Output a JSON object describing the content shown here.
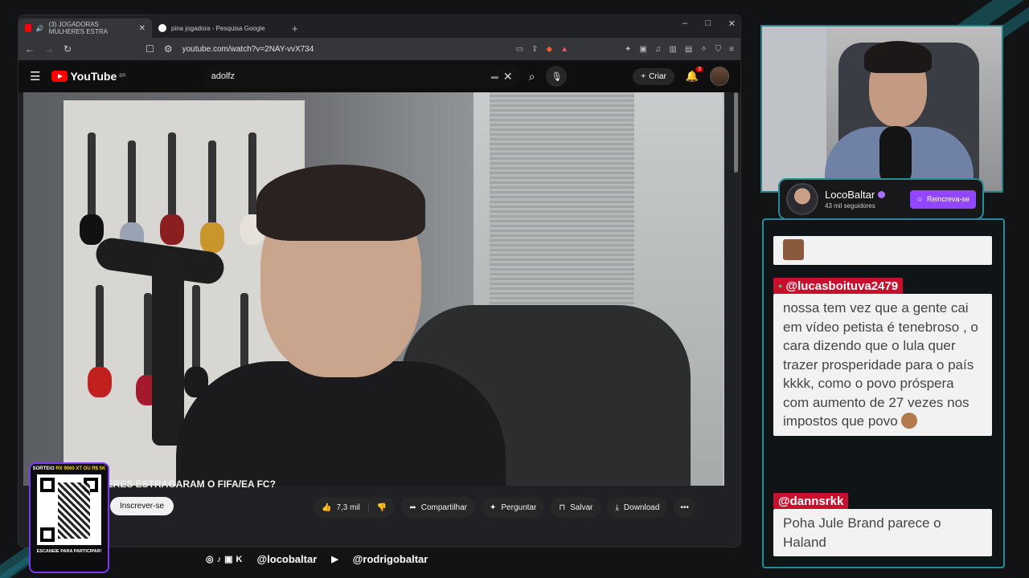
{
  "browser": {
    "tabs": [
      {
        "label": "(3) JOGADORAS MULHERES ESTRA",
        "active": true
      },
      {
        "label": "pina jogadora - Pesquisa Google",
        "active": false
      }
    ],
    "new_tab": "+",
    "url": "youtube.com/watch?v=2NAY-vvX734",
    "window_controls": {
      "minimize": "–",
      "maximize": "□",
      "close": "✕"
    }
  },
  "youtube": {
    "logo_text": "YouTube",
    "logo_region": "BR",
    "search_value": "adolfz",
    "create_label": "Criar",
    "notification_count": "3",
    "video_title": "HERES ESTRAGARAM O FIFA/EA FC?",
    "subscribe_label": "Inscrever-se",
    "likes": "7,3 mil",
    "share_label": "Compartilhar",
    "ask_label": "Perguntar",
    "save_label": "Salvar",
    "download_label": "Download",
    "more_label": "•••"
  },
  "stream": {
    "channel_name": "LocoBaltar",
    "followers": "43 mil seguidores",
    "resub_label": "Reincreva-se",
    "chat": [
      {
        "author": "",
        "text": ""
      },
      {
        "author": "@lucasboituva2479",
        "text": "nossa tem vez que a gente cai em vídeo petista é tenebroso , o cara dizendo que o lula quer trazer prosperidade para o país kkkk, como o povo próspera com aumento de 27 vezes nos impostos que povo"
      },
      {
        "author": "@dannsrkk",
        "text": "Poha Jule Brand parece o Haland"
      }
    ],
    "qr_top_prefix": "SORTEIO",
    "qr_top_highlight": "RX 9060 XT OU R$ 5K",
    "qr_bottom": "ESCANEIE PARA PARTICIPAR!",
    "socials": [
      "@locobaltar",
      "@rodrigobaltar"
    ]
  },
  "colors": {
    "accent_teal": "#2a8a96",
    "twitch_purple": "#9147ff",
    "youtube_red": "#ff0000",
    "author_badge_red": "#c8102e"
  }
}
